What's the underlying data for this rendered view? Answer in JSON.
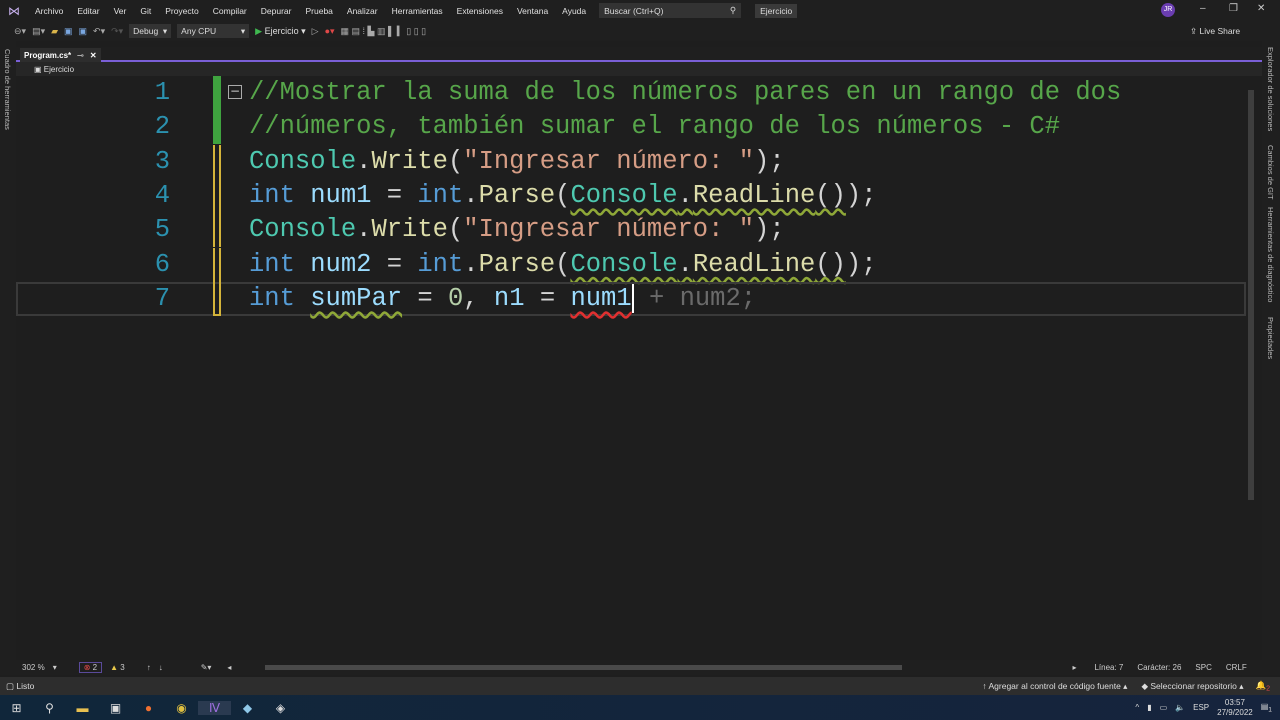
{
  "app": {
    "logo": "visual-studio-logo",
    "menu": [
      "Archivo",
      "Editar",
      "Ver",
      "Git",
      "Proyecto",
      "Compilar",
      "Depurar",
      "Prueba",
      "Analizar",
      "Herramientas",
      "Extensiones",
      "Ventana",
      "Ayuda"
    ],
    "search_placeholder": "Buscar (Ctrl+Q)",
    "project_name": "Ejercicio",
    "user_initials": "JR"
  },
  "toolbar": {
    "configuration": "Debug",
    "platform": "Any CPU",
    "run_target": "Ejercicio",
    "live_share": "Live Share"
  },
  "side_panels": {
    "left": "Cuadro de herramientas",
    "right": [
      "Explorador de soluciones",
      "Cambios de GIT",
      "Herramientas de diagnóstico",
      "Propiedades"
    ]
  },
  "tab": {
    "label": "Program.cs*"
  },
  "navbar": {
    "scope": "Ejercicio"
  },
  "code": [
    {
      "n": "1",
      "tokens": [
        [
          "t-com",
          "//Mostrar la suma de los números pares en un rango de dos"
        ]
      ]
    },
    {
      "n": "2",
      "tokens": [
        [
          "t-com",
          "//números, también sumar el rango de los números - C#"
        ]
      ]
    },
    {
      "n": "3",
      "tokens": [
        [
          "t-cls",
          "Console"
        ],
        [
          "t-pun",
          "."
        ],
        [
          "t-fn",
          "Write"
        ],
        [
          "t-pun",
          "("
        ],
        [
          "t-str",
          "\"Ingresar número: \""
        ],
        [
          "t-pun",
          ");"
        ]
      ]
    },
    {
      "n": "4",
      "tokens": [
        [
          "t-kw",
          "int"
        ],
        [
          "t-pun",
          " "
        ],
        [
          "t-var",
          "num1"
        ],
        [
          "t-pun",
          " = "
        ],
        [
          "t-kw",
          "int"
        ],
        [
          "t-pun",
          "."
        ],
        [
          "t-fn",
          "Parse"
        ],
        [
          "t-pun",
          "("
        ],
        [
          "t-cls sq-g",
          "Console"
        ],
        [
          "t-pun sq-g",
          "."
        ],
        [
          "t-fn sq-g",
          "ReadLine"
        ],
        [
          "t-pun sq-g",
          "()"
        ],
        [
          "t-pun",
          ");"
        ]
      ]
    },
    {
      "n": "5",
      "tokens": [
        [
          "t-cls",
          "Console"
        ],
        [
          "t-pun",
          "."
        ],
        [
          "t-fn",
          "Write"
        ],
        [
          "t-pun",
          "("
        ],
        [
          "t-str",
          "\"Ingresar número: \""
        ],
        [
          "t-pun",
          ");"
        ]
      ]
    },
    {
      "n": "6",
      "tokens": [
        [
          "t-kw",
          "int"
        ],
        [
          "t-pun",
          " "
        ],
        [
          "t-var",
          "num2"
        ],
        [
          "t-pun",
          " = "
        ],
        [
          "t-kw",
          "int"
        ],
        [
          "t-pun",
          "."
        ],
        [
          "t-fn",
          "Parse"
        ],
        [
          "t-pun",
          "("
        ],
        [
          "t-cls sq-g",
          "Console"
        ],
        [
          "t-pun sq-g",
          "."
        ],
        [
          "t-fn sq-g",
          "ReadLine"
        ],
        [
          "t-pun sq-g",
          "()"
        ],
        [
          "t-pun",
          ");"
        ]
      ]
    },
    {
      "n": "7",
      "tokens": [
        [
          "t-kw",
          "int"
        ],
        [
          "t-pun",
          " "
        ],
        [
          "t-var sq-g",
          "sumPar"
        ],
        [
          "t-pun",
          " = "
        ],
        [
          "t-num",
          "0"
        ],
        [
          "t-pun",
          ", "
        ],
        [
          "t-var",
          "n1"
        ],
        [
          "t-pun",
          " = "
        ],
        [
          "t-var sq-r",
          "num1"
        ],
        [
          "t-ghost",
          " + num2;"
        ]
      ]
    }
  ],
  "bottom": {
    "zoom": "302 %",
    "errors": "2",
    "warnings": "3",
    "line": "Línea: 7",
    "char": "Carácter: 26",
    "indent": "SPC",
    "eol": "CRLF"
  },
  "status": {
    "text": "Listo",
    "source_control": "Agregar al control de código fuente",
    "repo": "Seleccionar repositorio",
    "notifications": "2"
  },
  "taskbar": {
    "lang": "ESP",
    "time": "03:57",
    "date": "27/9/2022",
    "notif_count": "1"
  },
  "colors": {
    "accent": "#7a5fd6",
    "comment": "#57a64a",
    "keyword": "#569cd6"
  }
}
